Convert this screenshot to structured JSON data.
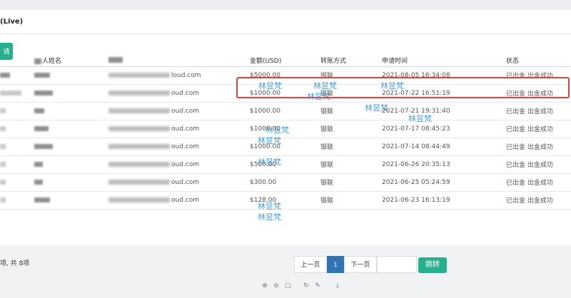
{
  "card": {
    "title": "(Live)",
    "apply_label": "请"
  },
  "table": {
    "headers": [
      "人姓名",
      "金额(USD)",
      "转账方式",
      "申请时间",
      "状态"
    ],
    "rows": [
      {
        "email": "loud.com",
        "amount": "$5000.00",
        "method": "银联",
        "time": "2021-08-05 16:34:08",
        "status": "已出金 出金成功"
      },
      {
        "email": "oud.com",
        "amount": "$1000.00",
        "method": "银联",
        "time": "2021-07-22 16:51:19",
        "status": "已出金 出金成功"
      },
      {
        "email": "oud.com",
        "amount": "$1000.00",
        "method": "银联",
        "time": "2021-07-21 19:31:40",
        "status": "已出金 出金成功"
      },
      {
        "email": "oud.com",
        "amount": "$1000.00",
        "method": "银联",
        "time": "2021-07-17 08:45:23",
        "status": "已出金 出金成功"
      },
      {
        "email": "oud.com",
        "amount": "$1000.00",
        "method": "银联",
        "time": "2021-07-14 08:44:49",
        "status": "已出金 出金成功"
      },
      {
        "email": "oud.com",
        "amount": "$500.00",
        "method": "银联",
        "time": "2021-06-26 20:35:13",
        "status": "已出金 出金成功"
      },
      {
        "email": "oud.com",
        "amount": "$300.00",
        "method": "银联",
        "time": "2021-06-25 05:24:59",
        "status": "已出金 出金成功"
      },
      {
        "email": "oud.com",
        "amount": "$128.00",
        "method": "银联",
        "time": "2021-06-23 16:13:19",
        "status": "已出金 出金成功"
      }
    ]
  },
  "watermark": "林昱梵",
  "footer": {
    "summary": "项, 共 8项",
    "prev": "上一页",
    "page": "1",
    "next": "下一页",
    "go": "跳转"
  },
  "colors": {
    "accent": "#26b08f",
    "page_active": "#2f74b5",
    "highlight": "#d9453b",
    "watermark": "#2d8fd8"
  },
  "toolbar_icons": [
    "zoom-in-icon",
    "zoom-out-icon",
    "fit-icon",
    "rotate-icon",
    "edit-icon",
    "download-icon"
  ]
}
